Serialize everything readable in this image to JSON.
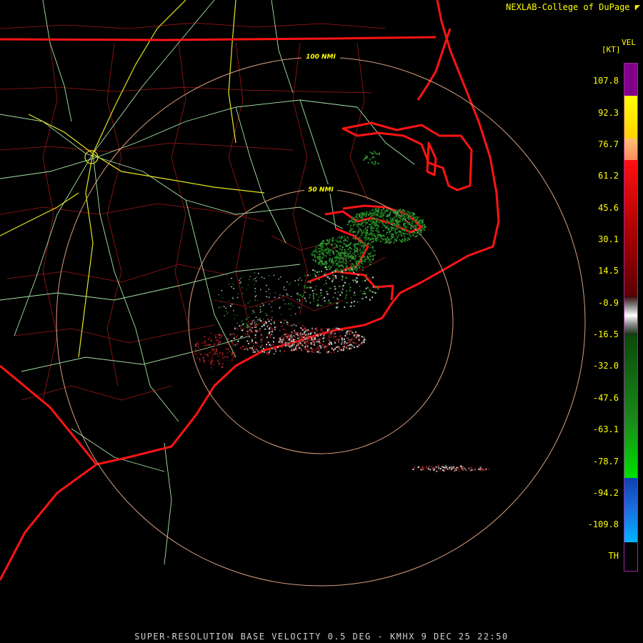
{
  "header": {
    "credit": "NEXLAB-College of DuPage"
  },
  "legend": {
    "product": "VEL",
    "units": "[KT]",
    "ticks": [
      "107.8",
      "92.3",
      "76.7",
      "61.2",
      "45.6",
      "30.1",
      "14.5",
      "-0.9",
      "-16.5",
      "-32.0",
      "-47.6",
      "-63.1",
      "-78.7",
      "-94.2",
      "-109.8",
      "TH"
    ],
    "colors": {
      "purple": "#80008a",
      "yellow": "#ffff00",
      "orange": "#ff9a60",
      "red": "#ff1414",
      "darkred": "#700000",
      "gray": "#c8c8c8",
      "green": "#1a6e1a",
      "brightgreen": "#00e000",
      "blue": "#1450c8",
      "cyan": "#00b4ff"
    }
  },
  "map": {
    "range_rings": [
      {
        "label": "50 NMI"
      },
      {
        "label": "100 NMI"
      }
    ]
  },
  "footer": {
    "caption": "SUPER-RESOLUTION BASE VELOCITY 0.5 DEG - KMHX 9 DEC 25 22:50"
  }
}
